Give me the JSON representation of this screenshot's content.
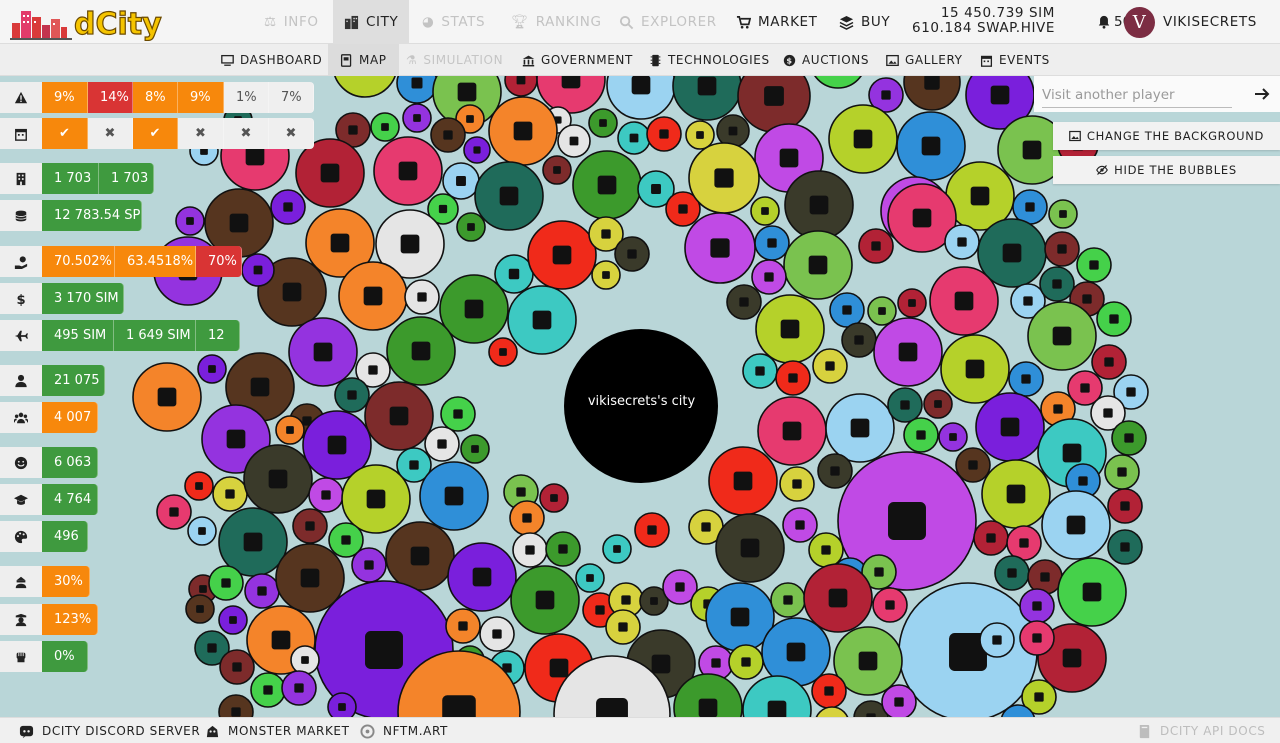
{
  "app": {
    "logo_text": "dCity"
  },
  "top_nav": [
    {
      "label": "INFO",
      "icon": "scale-icon",
      "state": "disabled"
    },
    {
      "label": "CITY",
      "icon": "city-icon",
      "state": "active"
    },
    {
      "label": "STATS",
      "icon": "pie-chart-icon",
      "state": "disabled"
    },
    {
      "label": "RANKING",
      "icon": "trophy-icon",
      "state": "disabled"
    },
    {
      "label": "EXPLORER",
      "icon": "search-icon",
      "state": "disabled"
    },
    {
      "label": "MARKET",
      "icon": "cart-icon",
      "state": "normal"
    },
    {
      "label": "BUY",
      "icon": "layers-icon",
      "state": "normal"
    }
  ],
  "wallet": {
    "sim": "15 450.739 SIM",
    "swap_hive": "610.184 SWAP.HIVE"
  },
  "notifications": {
    "count": "50"
  },
  "user": {
    "name": "VIKISECRETS",
    "avatar_letter": "V"
  },
  "sub_nav": [
    {
      "label": "DASHBOARD",
      "icon": "monitor-icon",
      "state": "normal"
    },
    {
      "label": "MAP",
      "icon": "map-icon",
      "state": "active"
    },
    {
      "label": "SIMULATION",
      "icon": "simulation-icon",
      "state": "disabled"
    },
    {
      "label": "GOVERNMENT",
      "icon": "government-icon",
      "state": "normal"
    },
    {
      "label": "TECHNOLOGIES",
      "icon": "chip-icon",
      "state": "normal"
    },
    {
      "label": "AUCTIONS",
      "icon": "auction-icon",
      "state": "normal"
    },
    {
      "label": "GALLERY",
      "icon": "gallery-icon",
      "state": "normal"
    },
    {
      "label": "EVENTS",
      "icon": "calendar-icon",
      "state": "normal"
    }
  ],
  "stats": [
    {
      "icon": "warning-icon",
      "cells": [
        {
          "t": "9%",
          "c": "o"
        },
        {
          "t": "14%",
          "c": "r"
        },
        {
          "t": "8%",
          "c": "o"
        },
        {
          "t": "9%",
          "c": "o"
        },
        {
          "t": "1%",
          "c": "w"
        },
        {
          "t": "7%",
          "c": "w"
        }
      ]
    },
    {
      "icon": "calendar-icon",
      "cells": [
        {
          "t": "✔",
          "c": "o"
        },
        {
          "t": "✖",
          "c": "w"
        },
        {
          "t": "✔",
          "c": "o"
        },
        {
          "t": "✖",
          "c": "w"
        },
        {
          "t": "✖",
          "c": "w"
        },
        {
          "t": "✖",
          "c": "w"
        }
      ]
    },
    {
      "icon": "building-icon",
      "cells": [
        {
          "t": "1 703",
          "c": "g"
        },
        {
          "t": "1 703",
          "c": "g"
        }
      ]
    },
    {
      "icon": "coins-icon",
      "cells": [
        {
          "t": "12 783.54 SP",
          "c": "g"
        }
      ]
    },
    {
      "icon": "hand-money-icon",
      "cells": [
        {
          "t": "70.502%",
          "c": "o"
        },
        {
          "t": "63.4518%",
          "c": "o"
        },
        {
          "t": "70%",
          "c": "r"
        }
      ]
    },
    {
      "icon": "dollar-icon",
      "cells": [
        {
          "t": "3 170 SIM",
          "c": "g"
        }
      ]
    },
    {
      "icon": "plane-icon",
      "cells": [
        {
          "t": "495 SIM",
          "c": "g"
        },
        {
          "t": "1 649 SIM",
          "c": "g"
        },
        {
          "t": "12",
          "c": "g"
        }
      ]
    },
    {
      "icon": "person-icon",
      "cells": [
        {
          "t": "21 075",
          "c": "g"
        }
      ]
    },
    {
      "icon": "people-icon",
      "cells": [
        {
          "t": "4 007",
          "c": "o"
        }
      ]
    },
    {
      "icon": "smile-icon",
      "cells": [
        {
          "t": "6 063",
          "c": "g"
        }
      ]
    },
    {
      "icon": "graduation-icon",
      "cells": [
        {
          "t": "4 764",
          "c": "g"
        }
      ]
    },
    {
      "icon": "palette-icon",
      "cells": [
        {
          "t": "496",
          "c": "g"
        }
      ]
    },
    {
      "icon": "thief-icon",
      "cells": [
        {
          "t": "30%",
          "c": "o"
        }
      ]
    },
    {
      "icon": "police-icon",
      "cells": [
        {
          "t": "123%",
          "c": "o"
        }
      ]
    },
    {
      "icon": "fist-icon",
      "cells": [
        {
          "t": "0%",
          "c": "g"
        }
      ]
    }
  ],
  "city": {
    "label": "vikisecrets's city"
  },
  "visit": {
    "placeholder": "Visit another player"
  },
  "actions": {
    "change_bg": "CHANGE THE BACKGROUND",
    "hide_bubbles": "HIDE THE BUBBLES"
  },
  "footer": {
    "discord": "DCITY DISCORD SERVER",
    "monster": "MONSTER MARKET",
    "nftm": "NFTM.ART",
    "api": "DCITY API DOCS"
  },
  "colors": {
    "background": "#b9d6d8",
    "green": "#3f9a3f",
    "orange": "#f7880c",
    "red": "#d93434",
    "bubble_palette": [
      "#7a1fdc",
      "#3c9a2c",
      "#d7d23e",
      "#b5d12a",
      "#b22236",
      "#1f6b5a",
      "#9433df",
      "#f4842a",
      "#3dc9c2",
      "#3a3a2a",
      "#2f8fd8",
      "#e63a6f",
      "#7d2b2b",
      "#56351f",
      "#e5e5e5",
      "#f02a1a",
      "#c04ae5",
      "#7ac24f",
      "#9bd3f1",
      "#45d14a"
    ]
  }
}
